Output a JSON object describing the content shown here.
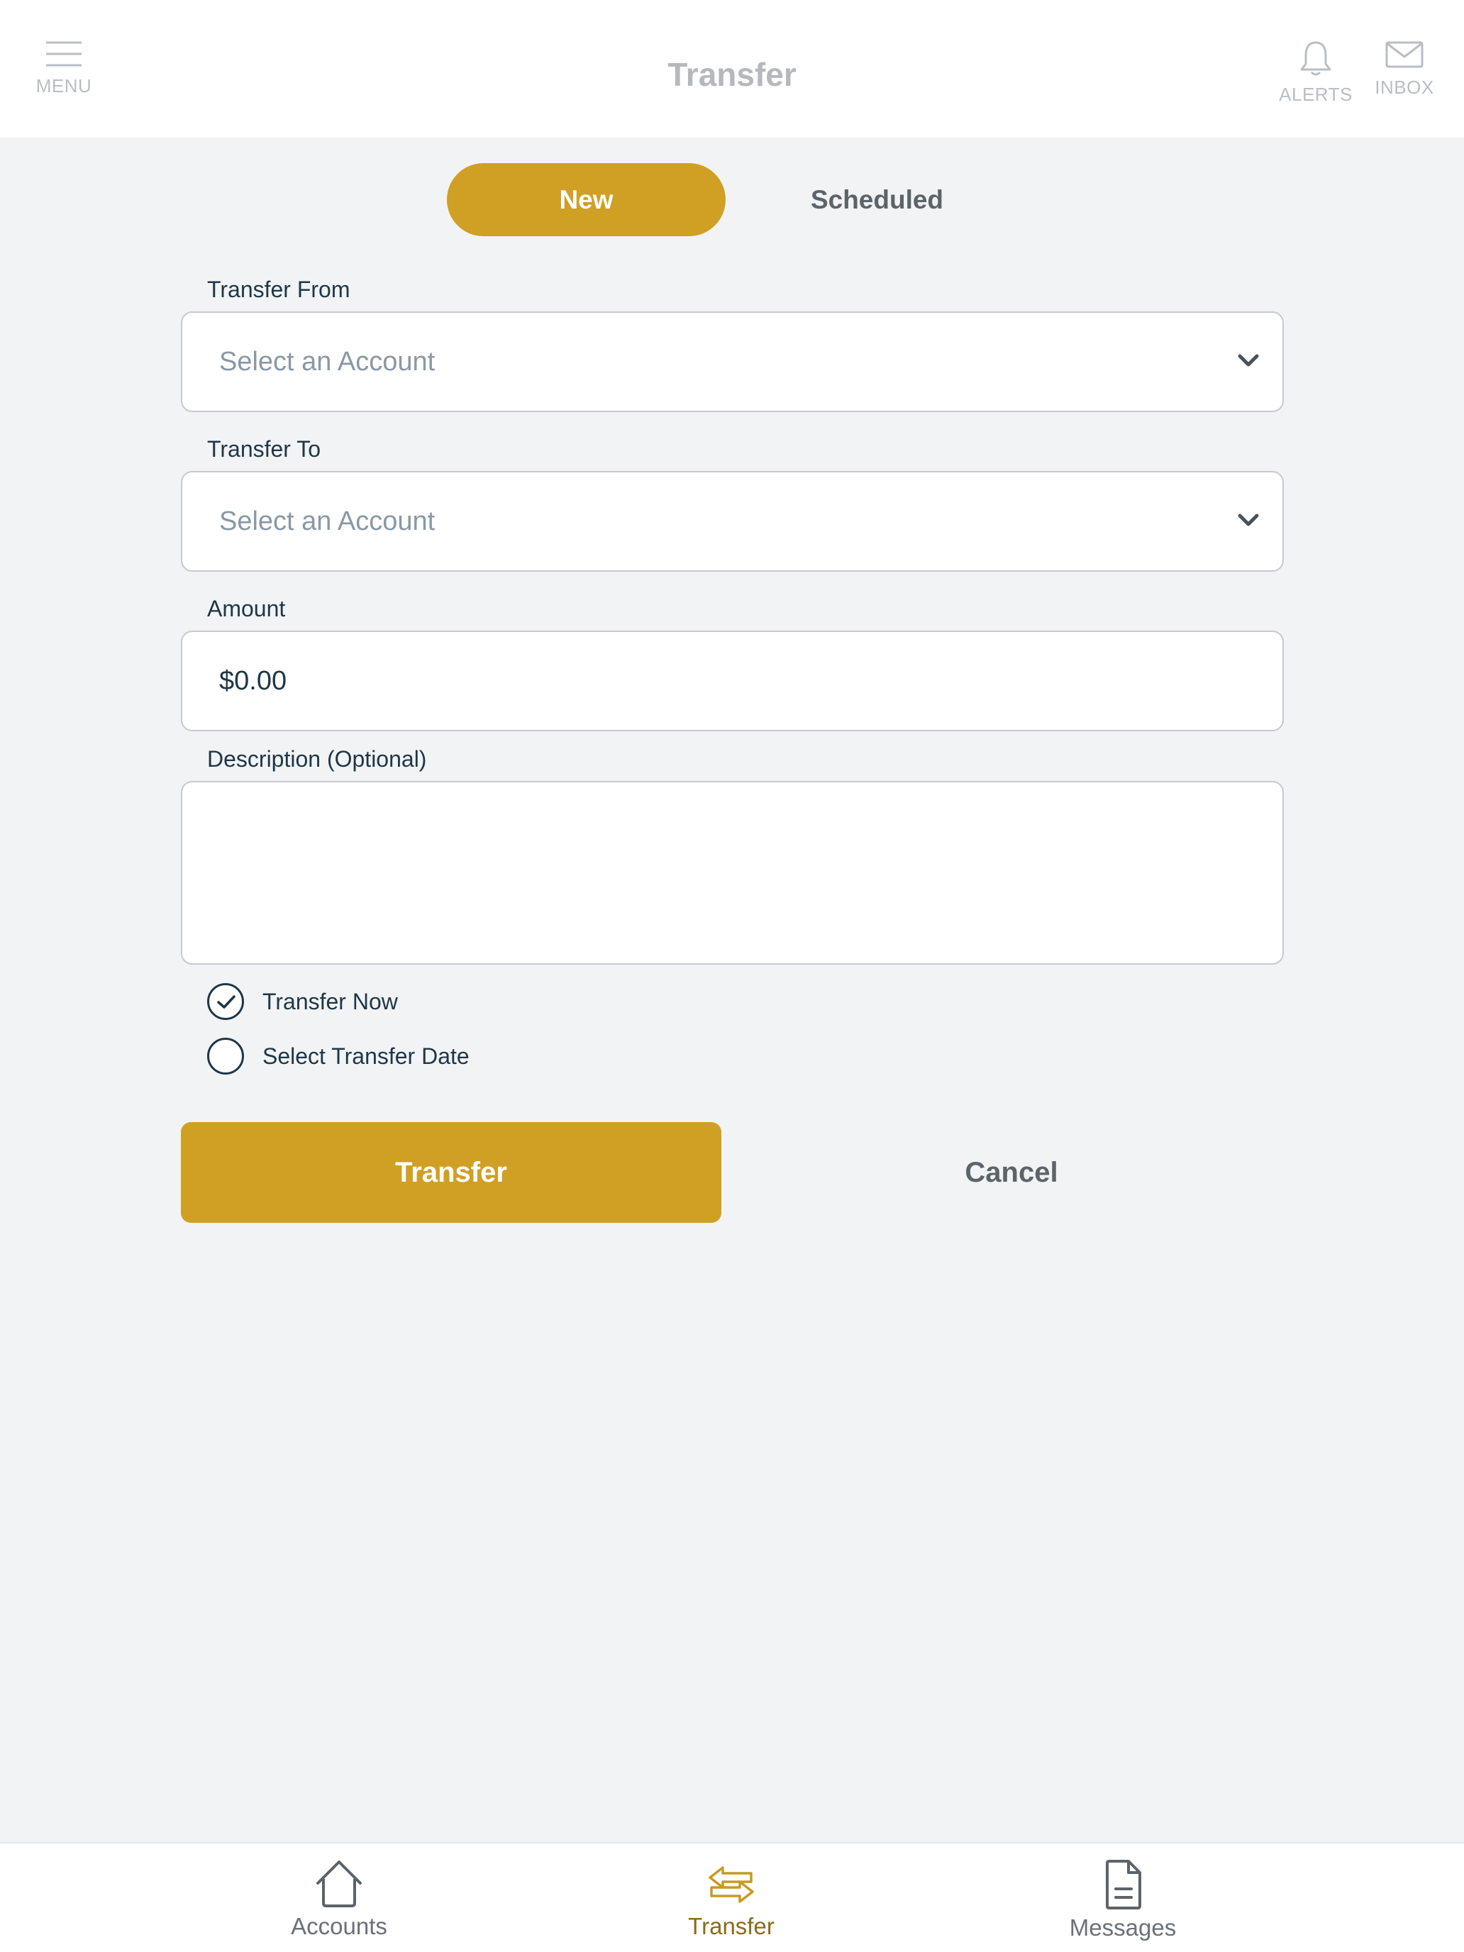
{
  "header": {
    "title": "Transfer",
    "menu_label": "MENU",
    "alerts_label": "ALERTS",
    "inbox_label": "INBOX"
  },
  "tabs": [
    {
      "label": "New",
      "active": true
    },
    {
      "label": "Scheduled",
      "active": false
    }
  ],
  "form": {
    "transfer_from": {
      "label": "Transfer From",
      "placeholder": "Select an Account"
    },
    "transfer_to": {
      "label": "Transfer To",
      "placeholder": "Select an Account"
    },
    "amount": {
      "label": "Amount",
      "value": "$0.00"
    },
    "description": {
      "label": "Description (Optional)",
      "value": ""
    },
    "timing_options": [
      {
        "label": "Transfer Now",
        "selected": true
      },
      {
        "label": "Select Transfer Date",
        "selected": false
      }
    ],
    "submit_label": "Transfer",
    "cancel_label": "Cancel"
  },
  "bottom_nav": [
    {
      "label": "Accounts",
      "icon": "home-icon",
      "active": false
    },
    {
      "label": "Transfer",
      "icon": "transfer-arrows-icon",
      "active": true
    },
    {
      "label": "Messages",
      "icon": "document-icon",
      "active": false
    }
  ],
  "colors": {
    "accent": "#d0a024",
    "background": "#f2f3f5",
    "text_primary": "#1e3748",
    "placeholder": "#8a98a3"
  }
}
